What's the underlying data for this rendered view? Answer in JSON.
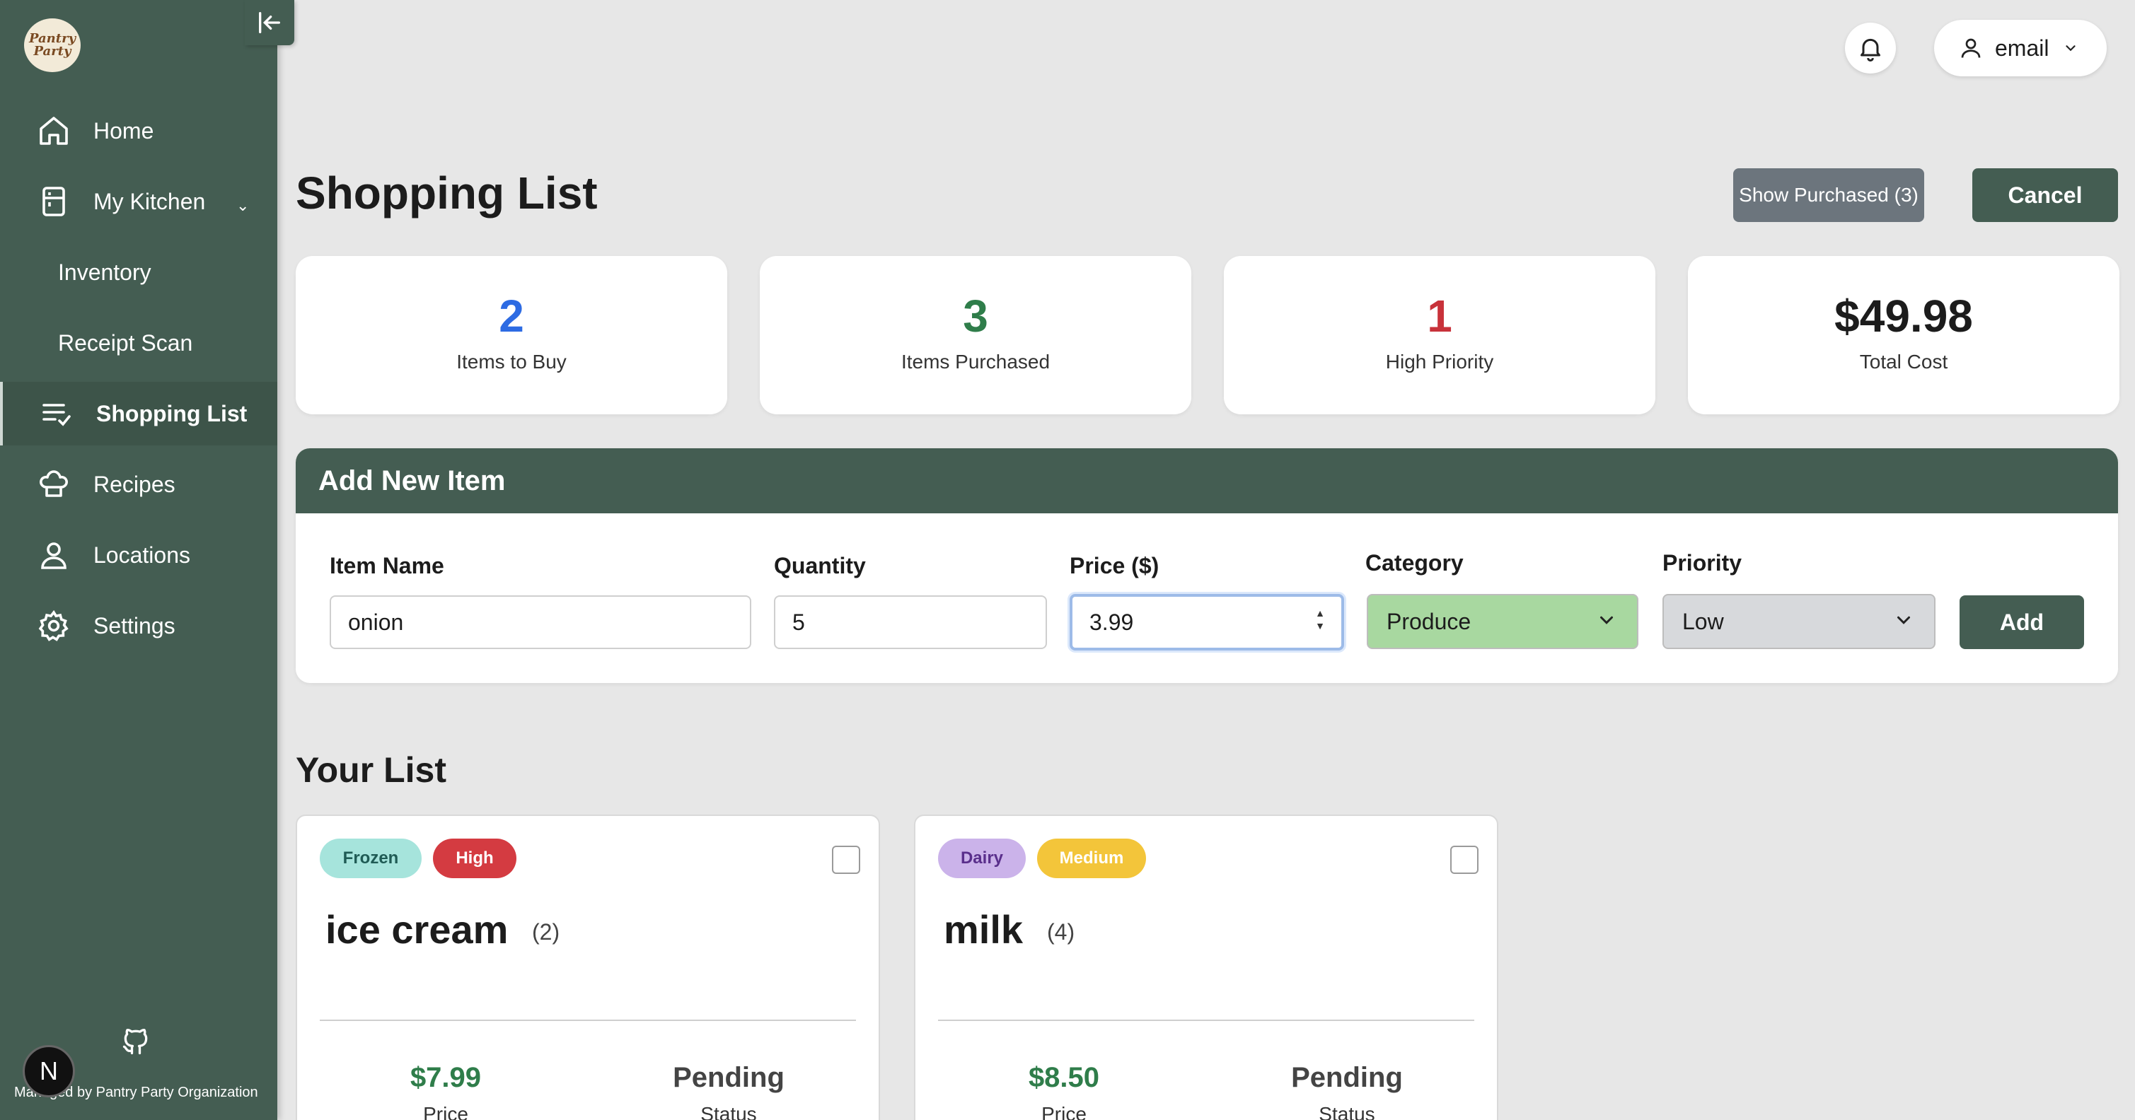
{
  "brand": {
    "logo_text": "Pantry Party"
  },
  "sidebar": {
    "items": [
      {
        "label": "Home",
        "icon": "home-icon"
      },
      {
        "label": "My Kitchen",
        "icon": "fridge-icon"
      },
      {
        "label": "Inventory"
      },
      {
        "label": "Receipt Scan"
      },
      {
        "label": "Shopping List",
        "icon": "checklist-icon",
        "active": true
      },
      {
        "label": "Recipes",
        "icon": "chef-hat-icon"
      },
      {
        "label": "Locations",
        "icon": "location-icon"
      },
      {
        "label": "Settings",
        "icon": "gear-icon"
      }
    ],
    "footer_badge": "N",
    "footer_text": "Managed by Pantry Party Organization"
  },
  "topbar": {
    "user_label": "email"
  },
  "header": {
    "title": "Shopping List",
    "show_purchased_label": "Show Purchased (3)",
    "cancel_label": "Cancel"
  },
  "stats": [
    {
      "value": "2",
      "caption": "Items to Buy",
      "color": "#2d6be3"
    },
    {
      "value": "3",
      "caption": "Items Purchased",
      "color": "#2f7d4a"
    },
    {
      "value": "1",
      "caption": "High Priority",
      "color": "#c8323a"
    },
    {
      "value": "$49.98",
      "caption": "Total Cost",
      "color": "#1c1c1c"
    }
  ],
  "add_form": {
    "title": "Add New Item",
    "item_name": {
      "label": "Item Name",
      "value": "onion"
    },
    "quantity": {
      "label": "Quantity",
      "value": "5"
    },
    "price": {
      "label": "Price ($)",
      "value": "3.99"
    },
    "category": {
      "label": "Category",
      "value": "Produce",
      "color": "#a8d8a0"
    },
    "priority": {
      "label": "Priority",
      "value": "Low",
      "color": "#d7d9dc"
    },
    "add_label": "Add"
  },
  "list": {
    "title": "Your List",
    "items": [
      {
        "tags": [
          {
            "label": "Frozen",
            "bg": "#a6e4dc",
            "fg": "#1f5b55"
          },
          {
            "label": "High",
            "bg": "#d43b41",
            "fg": "#ffffff"
          }
        ],
        "name": "ice cream",
        "qty": "(2)",
        "price": "$7.99",
        "price_caption": "Price",
        "status": "Pending",
        "status_caption": "Status"
      },
      {
        "tags": [
          {
            "label": "Dairy",
            "bg": "#cbb3ea",
            "fg": "#5a2f8c"
          },
          {
            "label": "Medium",
            "bg": "#f3c53a",
            "fg": "#ffffff"
          }
        ],
        "name": "milk",
        "qty": "(4)",
        "price": "$8.50",
        "price_caption": "Price",
        "status": "Pending",
        "status_caption": "Status"
      }
    ]
  }
}
